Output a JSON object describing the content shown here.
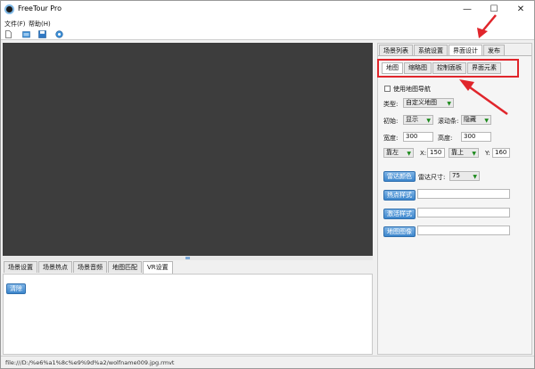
{
  "window": {
    "title": "FreeTour Pro",
    "controls": {
      "minimize": "—",
      "maximize": "☐",
      "close": "✕"
    }
  },
  "menu": {
    "items": [
      "文件(F)",
      "帮助(H)"
    ]
  },
  "toolbar": {
    "icons": [
      "new-file-icon",
      "open-folder-icon",
      "save-icon",
      "settings-icon"
    ]
  },
  "bottom": {
    "tabs": [
      "场景设置",
      "场景热点",
      "场景音频",
      "地图匹配",
      "VR设置"
    ],
    "active_tab": 4,
    "vr_button": "清除"
  },
  "right": {
    "tabs": [
      "场景列表",
      "系统设置",
      "界面设计",
      "发布"
    ],
    "active_tab": 2,
    "sub_tabs": [
      "地图",
      "缩略图",
      "控制面板",
      "界面元素"
    ],
    "active_sub_tab": 0,
    "use_map_nav": "使用地图导航",
    "type_label": "类型:",
    "type_value": "自定义地图",
    "init_label": "初始:",
    "init_value": "显示",
    "scroll_label": "滚动条:",
    "scroll_value": "隐藏",
    "width_label": "宽度:",
    "width_value": "300",
    "height_label": "高度:",
    "height_value": "300",
    "hpos_value": "靠左",
    "x_label": "X:",
    "x_value": "150",
    "vpos_value": "靠上",
    "y_label": "Y:",
    "y_value": "160",
    "radar_color_btn": "雷达颜色",
    "radar_size_label": "雷达尺寸:",
    "radar_size_value": "75",
    "hotspot_btn": "热点样式",
    "select_btn": "激活样式",
    "map_image_btn": "地图图像"
  },
  "status": {
    "text": "file:///D:/%e6%a1%8c%e9%9d%a2/wolfname009.jpg.rmvt"
  },
  "colors": {
    "highlight": "#e0252b",
    "button": "#3c86cc"
  }
}
